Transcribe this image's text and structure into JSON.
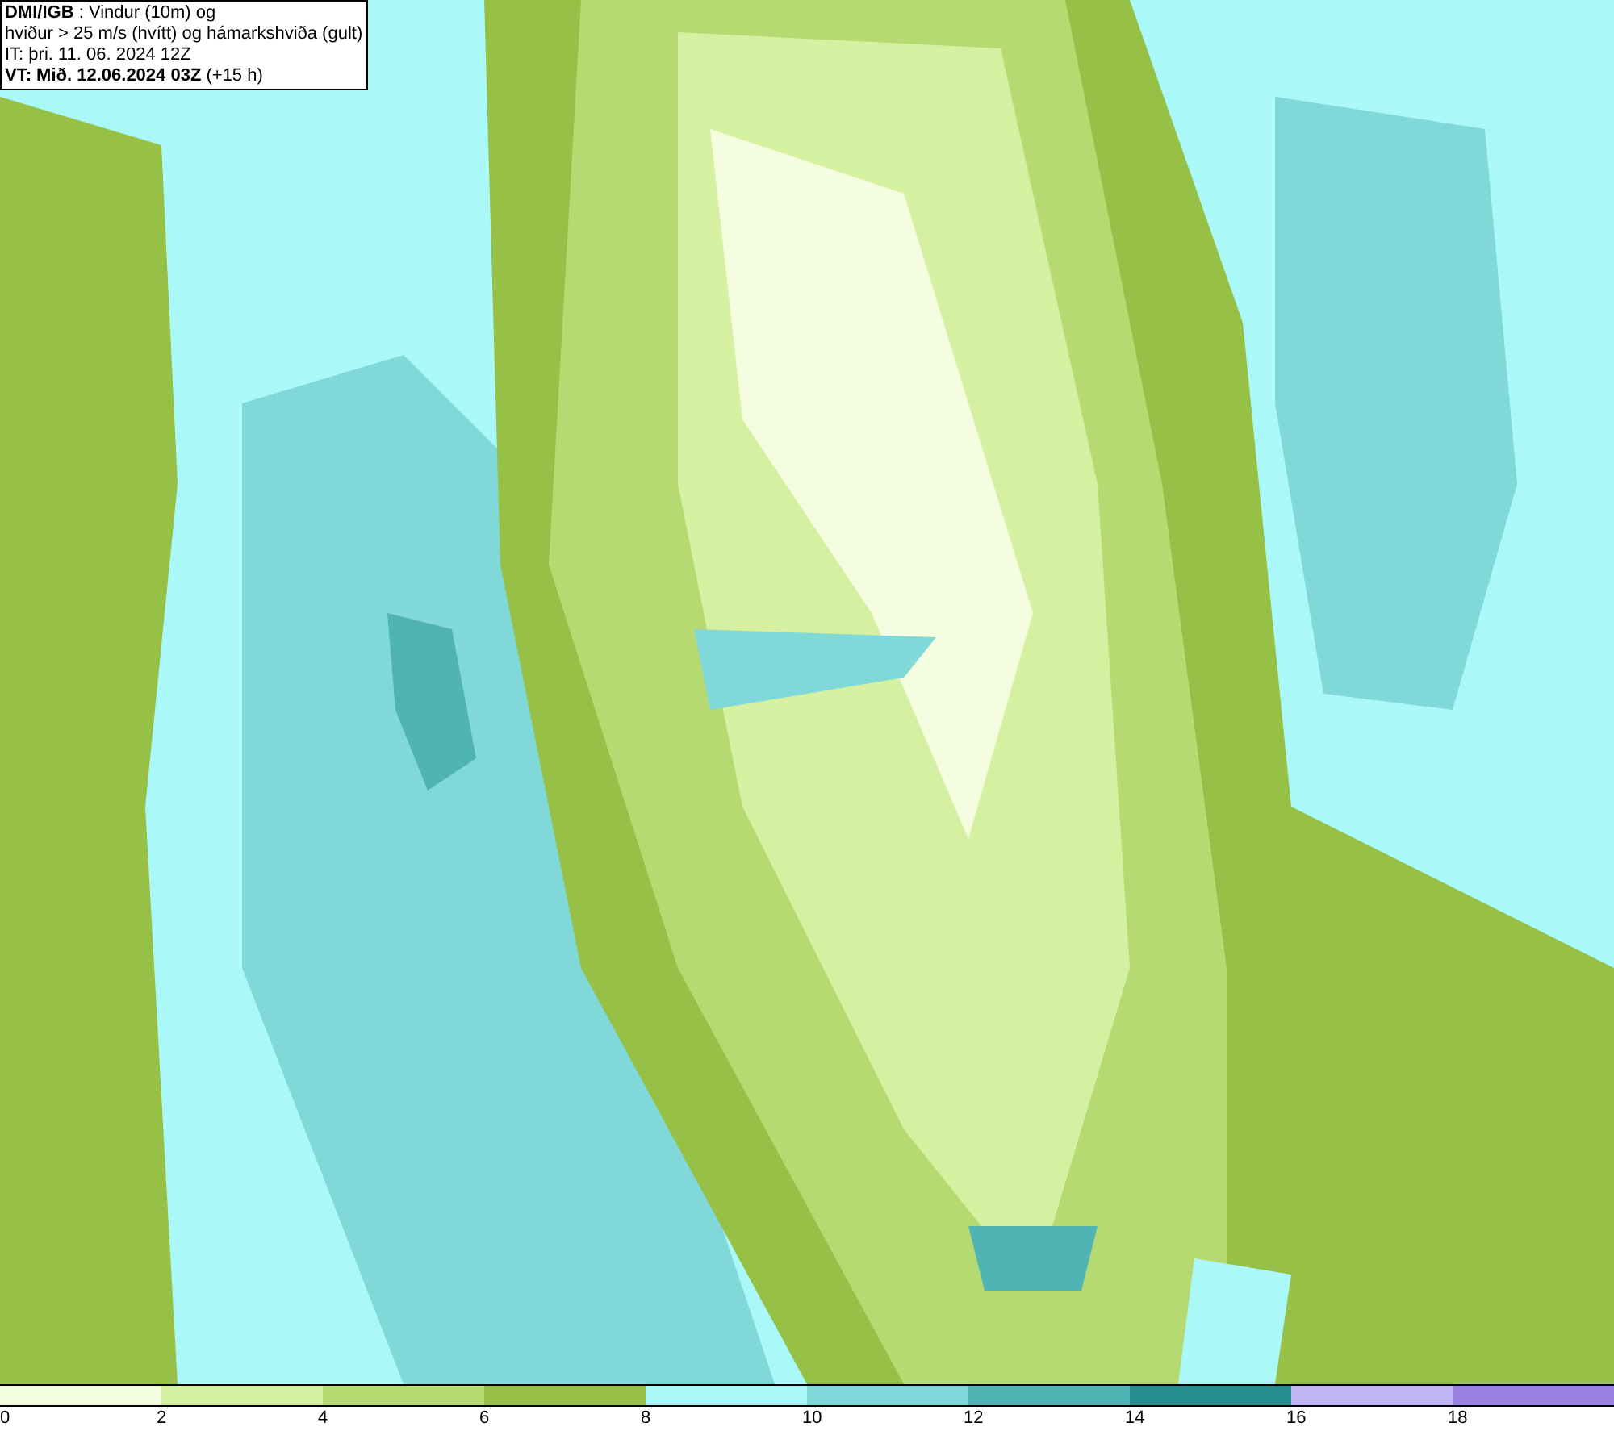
{
  "title_box": {
    "lines": [
      "**DMI/IGB** : Vindur (10m) og",
      "hviður > 25 m/s (hvítt) og hámarkshviða (gult)",
      "IT: þri. 11. 06. 2024 12Z",
      "**VT: Mið. 12.06.2024 03Z** (+15 h)"
    ]
  },
  "legend": {
    "bins": [
      {
        "color": "#f5fde0"
      },
      {
        "color": "#d4f0a0"
      },
      {
        "color": "#b6da72"
      },
      {
        "color": "#96c146"
      },
      {
        "color": "#aaf8f8"
      },
      {
        "color": "#80d8d8"
      },
      {
        "color": "#50b4b4"
      },
      {
        "color": "#269090"
      },
      {
        "color": "#c0b4f4"
      },
      {
        "color": "#9a80e0"
      }
    ],
    "labels": [
      "0",
      "2",
      "4",
      "6",
      "8",
      "10",
      "12",
      "14",
      "16",
      "18"
    ]
  }
}
